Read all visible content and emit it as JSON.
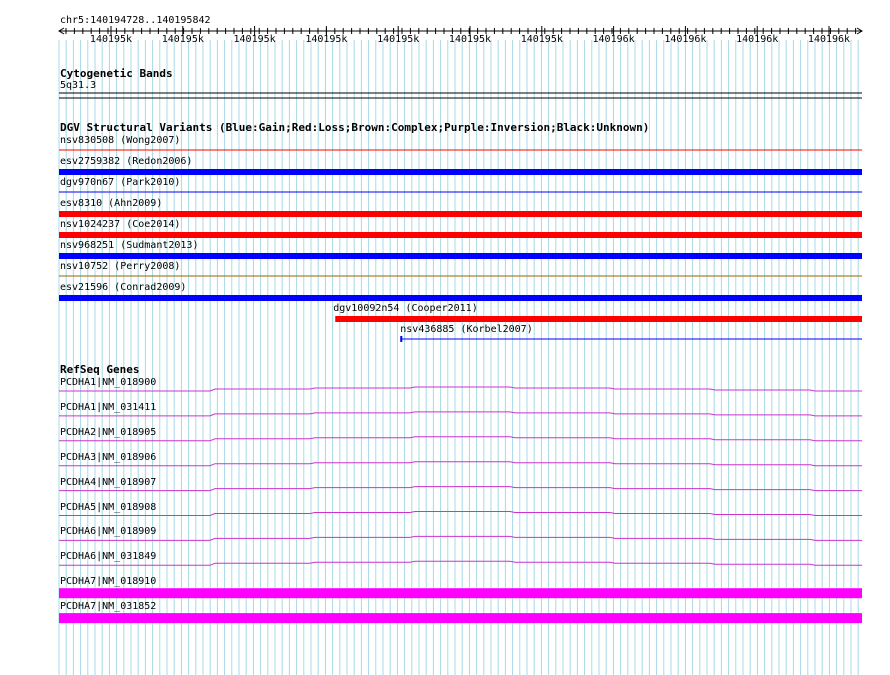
{
  "region": "chr5:140194728..140195842",
  "ruler": {
    "tick_labels": [
      "140195k",
      "140195k",
      "140195k",
      "140195k",
      "140195k",
      "140195k",
      "140195k",
      "140196k",
      "140196k",
      "140196k",
      "140196k"
    ]
  },
  "cyto": {
    "title": "Cytogenetic Bands",
    "band": "5q31.3"
  },
  "dgv": {
    "title": "DGV Structural Variants (Blue:Gain;Red:Loss;Brown:Complex;Purple:Inversion;Black:Unknown)",
    "variants": [
      {
        "label": "nsv830508 (Wong2007)",
        "color": "#ff0000",
        "start": 0,
        "end": 1,
        "thick": false
      },
      {
        "label": "esv2759382 (Redon2006)",
        "color": "#0000ff",
        "start": 0,
        "end": 1,
        "thick": true
      },
      {
        "label": "dgv970n67 (Park2010)",
        "color": "#0000ff",
        "start": 0,
        "end": 1,
        "thick": false
      },
      {
        "label": "esv8310 (Ahn2009)",
        "color": "#ff0000",
        "start": 0,
        "end": 1,
        "thick": true
      },
      {
        "label": "nsv1024237 (Coe2014)",
        "color": "#ff0000",
        "start": 0,
        "end": 1,
        "thick": true
      },
      {
        "label": "nsv968251 (Sudmant2013)",
        "color": "#0000ff",
        "start": 0,
        "end": 1,
        "thick": true
      },
      {
        "label": "nsv10752 (Perry2008)",
        "color": "#996600",
        "start": 0,
        "end": 1,
        "thick": false
      },
      {
        "label": "esv21596 (Conrad2009)",
        "color": "#0000ff",
        "start": 0,
        "end": 1,
        "thick": true
      },
      {
        "label": "dgv10092n54 (Cooper2011)",
        "color": "#ff0000",
        "start": 0.344,
        "end": 1,
        "thick": true
      },
      {
        "label": "nsv436885 (Korbel2007)",
        "color": "#0000ff",
        "start": 0.425,
        "end": 1,
        "thick": false
      }
    ]
  },
  "refseq": {
    "title": "RefSeq Genes",
    "genes": [
      {
        "label": "PCDHA1|NM_018900",
        "color": "#cc33cc",
        "thick": false
      },
      {
        "label": "PCDHA1|NM_031411",
        "color": "#cc33cc",
        "thick": false
      },
      {
        "label": "PCDHA2|NM_018905",
        "color": "#cc33cc",
        "thick": false
      },
      {
        "label": "PCDHA3|NM_018906",
        "color": "#cc33cc",
        "thick": false
      },
      {
        "label": "PCDHA4|NM_018907",
        "color": "#cc33cc",
        "thick": false
      },
      {
        "label": "PCDHA5|NM_018908",
        "color": "#cc33cc",
        "thick": false
      },
      {
        "label": "PCDHA6|NM_018909",
        "color": "#cc33cc",
        "thick": false
      },
      {
        "label": "PCDHA6|NM_031849",
        "color": "#cc33cc",
        "thick": false
      },
      {
        "label": "PCDHA7|NM_018910",
        "color": "#ff00ff",
        "thick": true
      },
      {
        "label": "PCDHA7|NM_031852",
        "color": "#ff00ff",
        "thick": true
      }
    ]
  },
  "colors": {
    "grid": "#a8d8e8",
    "axis": "#000000"
  }
}
